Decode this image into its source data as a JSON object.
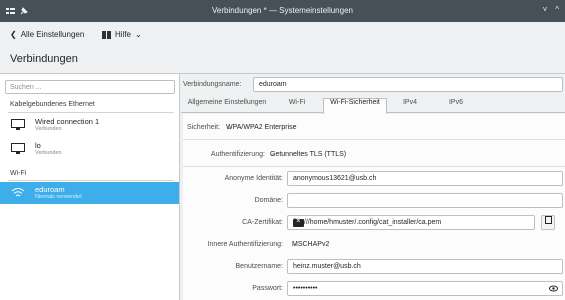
{
  "window": {
    "title": "Verbindungen * — Systemeinstellungen",
    "controls": [
      "˅",
      "^"
    ]
  },
  "toolbar": {
    "back_label": "Alle Einstellungen",
    "help_label": "Hilfe"
  },
  "page": {
    "title": "Verbindungen"
  },
  "sidebar": {
    "search_placeholder": "Suchen ...",
    "sections": [
      {
        "title": "Kabelgebundenes Ethernet",
        "items": [
          {
            "name": "Wired connection 1",
            "status": "Verbunden"
          },
          {
            "name": "lo",
            "status": "Verbunden"
          }
        ]
      },
      {
        "title": "Wi-Fi",
        "items": [
          {
            "name": "eduroam",
            "status": "Niemals verwendet",
            "selected": true
          }
        ]
      }
    ]
  },
  "form": {
    "connection_name_label": "Verbindungsname:",
    "connection_name": "eduroam",
    "tabs": [
      "Allgemeine Einstellungen",
      "Wi-Fi",
      "Wi-Fi-Sicherheit",
      "IPv4",
      "IPv6"
    ],
    "active_tab": "Wi-Fi-Sicherheit",
    "security_label": "Sicherheit:",
    "security_value": "WPA/WPA2 Enterprise",
    "auth_label": "Authentifizierung:",
    "auth_value": "Getunneltes TLS (TTLS)",
    "anon_label": "Anonyme Identität:",
    "anon_value": "anonymous13621@usb.ch",
    "domain_label": "Domäne:",
    "domain_value": "",
    "ca_label": "CA-Zertifikat:",
    "ca_value": "file:///home/hmuster/.config/cat_installer/ca.pem",
    "inner_auth_label": "Innere Authentifizierung:",
    "inner_auth_value": "MSCHAPv2",
    "user_label": "Benutzername:",
    "user_value": "heinz.muster@usb.ch",
    "password_label": "Passwort:",
    "password_value": "••••••••••"
  },
  "colors": {
    "accent": "#3daee9",
    "titlebar": "#475057"
  }
}
